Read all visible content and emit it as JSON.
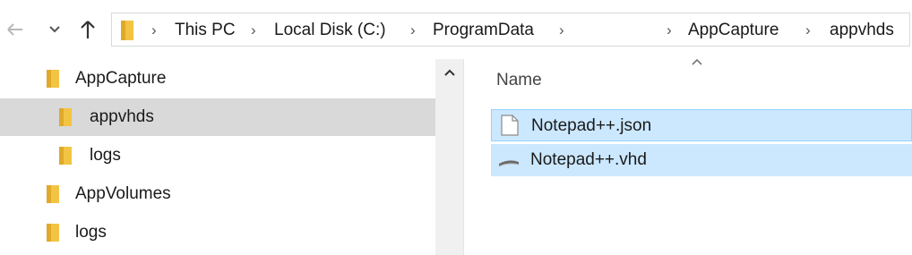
{
  "toolbar": {
    "back_icon": "arrow-left-icon",
    "recent_icon": "chevron-down-icon",
    "up_icon": "arrow-up-icon"
  },
  "address_bar": {
    "folder_icon": "folder-icon",
    "crumbs": [
      "This PC",
      "Local Disk (C:)",
      "ProgramData",
      "AppCapture",
      "appvhds"
    ],
    "separator": "›"
  },
  "nav_pane": {
    "items": [
      {
        "label": "AppCapture",
        "selected": false
      },
      {
        "label": "appvhds",
        "selected": true
      },
      {
        "label": "logs",
        "selected": false
      },
      {
        "label": "AppVolumes",
        "selected": false
      },
      {
        "label": "logs",
        "selected": false
      }
    ]
  },
  "file_list": {
    "column_name": "Name",
    "sort_icon": "sort-ascending-icon",
    "files": [
      {
        "name": "Notepad++.json",
        "icon": "document-icon",
        "selected": true
      },
      {
        "name": "Notepad++.vhd",
        "icon": "disk-image-icon",
        "selected": true
      }
    ]
  },
  "colors": {
    "folder": "#f3c443",
    "selection_nav": "#d9d9d9",
    "selection_files": "#cce8ff",
    "selection_border": "#99d1ff"
  }
}
